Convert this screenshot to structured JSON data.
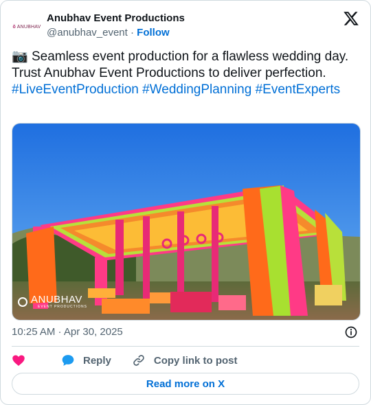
{
  "author": {
    "display_name": "Anubhav Event Productions",
    "handle": "@anubhav_event",
    "separator": "·",
    "follow_label": "Follow",
    "avatar_text": "ANUBHAV"
  },
  "tweet": {
    "emoji": "📷",
    "text": " Seamless event production for a flawless wedding day. Trust Anubhav Event Productions to deliver perfection. ",
    "hashtags": [
      "#LiveEventProduction",
      "#WeddingPlanning",
      "#EventExperts"
    ],
    "timestamp": "10:25 AM · Apr 30, 2025"
  },
  "media": {
    "watermark_brand": "ANUBHAV",
    "watermark_sub": "EVENT PRODUCTIONS",
    "description_icon": "wedding-canopy-photo"
  },
  "actions": {
    "like_icon": "heart-icon",
    "reply_label": "Reply",
    "copy_label": "Copy link to post",
    "read_more_label": "Read more on X"
  },
  "colors": {
    "link": "#006fd6",
    "muted": "#536471",
    "heart": "#f91880",
    "reply_bubble": "#1d9bf0",
    "border": "#cfd9de"
  }
}
